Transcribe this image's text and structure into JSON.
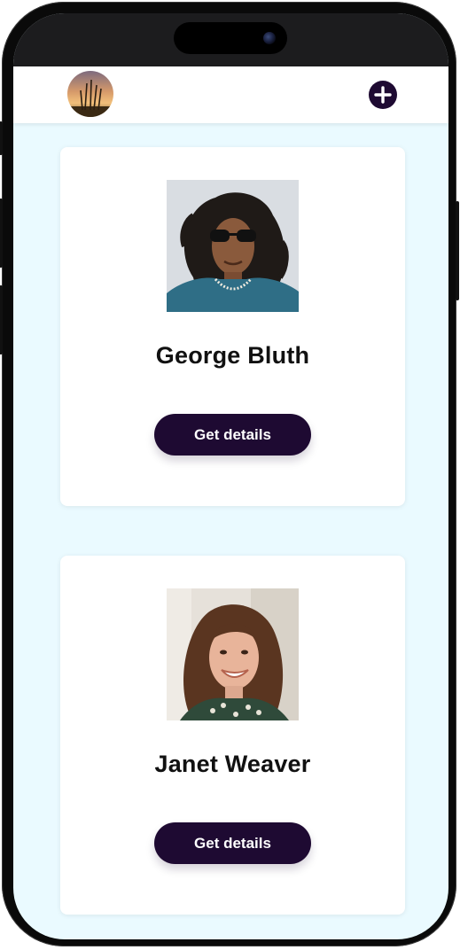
{
  "app": {
    "header": {
      "avatar_icon": "profile-avatar",
      "add_icon": "plus-circle-icon"
    },
    "users": [
      {
        "name": "George Bluth",
        "button_label": "Get details",
        "photo_icon": "portrait-man-sunglasses"
      },
      {
        "name": "Janet Weaver",
        "button_label": "Get details",
        "photo_icon": "portrait-woman-smiling"
      }
    ]
  },
  "colors": {
    "accent": "#1e0a32",
    "background": "#eafaff",
    "card": "#ffffff"
  }
}
